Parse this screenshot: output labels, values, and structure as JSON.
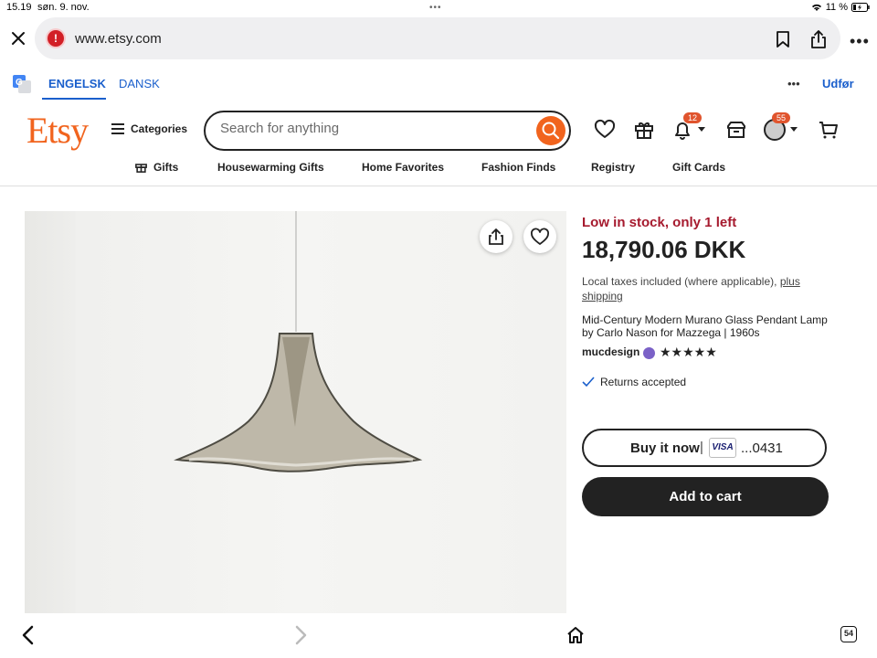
{
  "status_bar": {
    "time": "15.19",
    "date": "søn. 9. nov.",
    "battery": "11 %"
  },
  "browser": {
    "url": "www.etsy.com"
  },
  "translate_bar": {
    "lang_source": "ENGELSK",
    "lang_target": "DANSK",
    "done_label": "Udfør"
  },
  "header": {
    "logo": "Etsy",
    "categories_label": "Categories",
    "search_placeholder": "Search for anything",
    "notifications_count": "12",
    "account_count": "55"
  },
  "nav": {
    "items": [
      "Gifts",
      "Housewarming Gifts",
      "Home Favorites",
      "Fashion Finds",
      "Registry",
      "Gift Cards"
    ]
  },
  "product": {
    "stock_notice": "Low in stock, only 1 left",
    "price": "18,790.06 DKK",
    "tax_text": "Local taxes included (where applicable),",
    "shipping_link": "plus shipping",
    "title": "Mid-Century Modern Murano Glass Pendant Lamp by Carlo Nason for Mazzega | 1960s",
    "shop_name": "mucdesign",
    "rating_stars": "★★★★★",
    "returns": "Returns accepted",
    "buy_now_label": "Buy it now",
    "card_brand": "VISA",
    "card_last4": "...0431",
    "add_to_cart_label": "Add to cart"
  },
  "bottom_bar": {
    "tab_count": "54"
  },
  "colors": {
    "brand": "#f1641e",
    "stock": "#a61a2e",
    "link": "#1a5fcc"
  }
}
